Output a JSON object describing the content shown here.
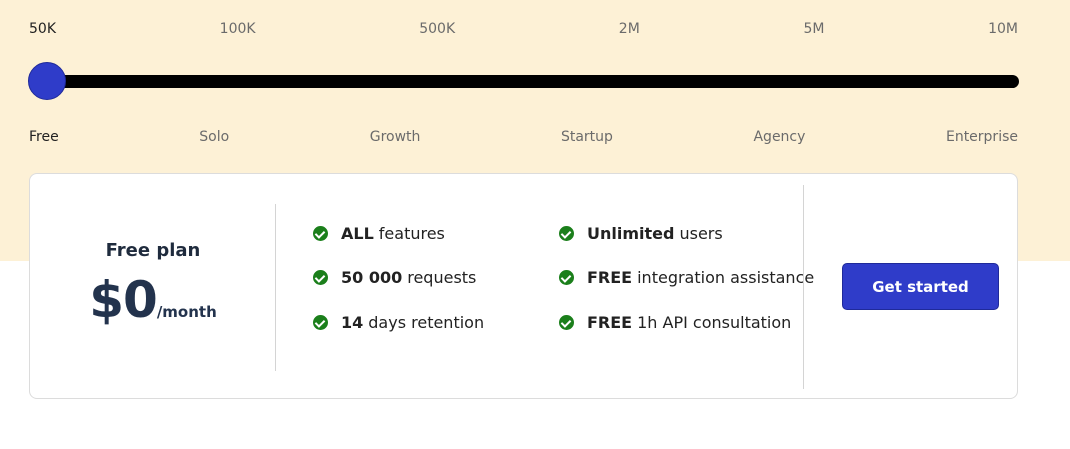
{
  "slider": {
    "ticks": [
      "50K",
      "100K",
      "500K",
      "2M",
      "5M",
      "10M"
    ],
    "tiers": [
      "Free",
      "Solo",
      "Growth",
      "Startup",
      "Agency",
      "Enterprise"
    ],
    "selected_index": 0,
    "track_color": "#000000",
    "thumb_color": "#2f3cc9"
  },
  "plan": {
    "name": "Free plan",
    "price": "$0",
    "period": "/month"
  },
  "features": [
    {
      "bold": "ALL",
      "text": "features"
    },
    {
      "bold": "Unlimited",
      "text": "users"
    },
    {
      "bold": "50 000",
      "text": "requests"
    },
    {
      "bold": "FREE",
      "text": "integration assistance"
    },
    {
      "bold": "14",
      "text": "days retention"
    },
    {
      "bold": "FREE",
      "text": "1h API consultation"
    }
  ],
  "cta": {
    "label": "Get started"
  },
  "colors": {
    "band": "#fdf1d6",
    "accent": "#2f3cc9",
    "check": "#1b7f1b"
  }
}
